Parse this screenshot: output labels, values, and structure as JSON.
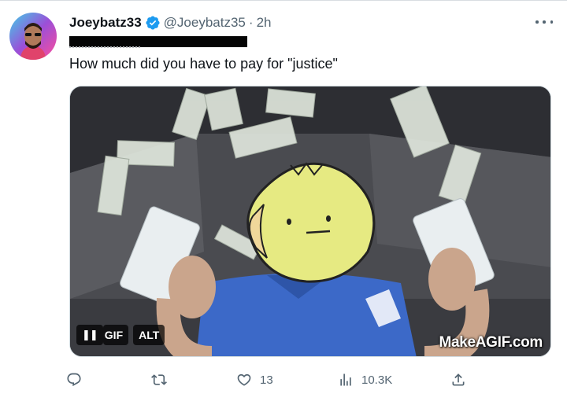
{
  "post": {
    "display_name": "Joeybatz33",
    "handle": "@Joeybatz35",
    "separator": "·",
    "time": "2h",
    "text": "How much did you have to pay for \"justice\""
  },
  "media": {
    "type": "GIF",
    "pause_label": "❚❚",
    "gif_label": "GIF",
    "alt_label": "ALT",
    "watermark": "MakeAGIF.com"
  },
  "actions": {
    "reply_count": "",
    "retweet_count": "",
    "like_count": "13",
    "views_count": "10.3K"
  },
  "colors": {
    "text": "#0f1419",
    "secondary": "#536471",
    "verified": "#1d9bf0",
    "border": "#cfd9de"
  },
  "icons": [
    "verified-badge-icon",
    "more-options-icon",
    "reply-icon",
    "retweet-icon",
    "like-icon",
    "views-icon",
    "share-icon"
  ]
}
